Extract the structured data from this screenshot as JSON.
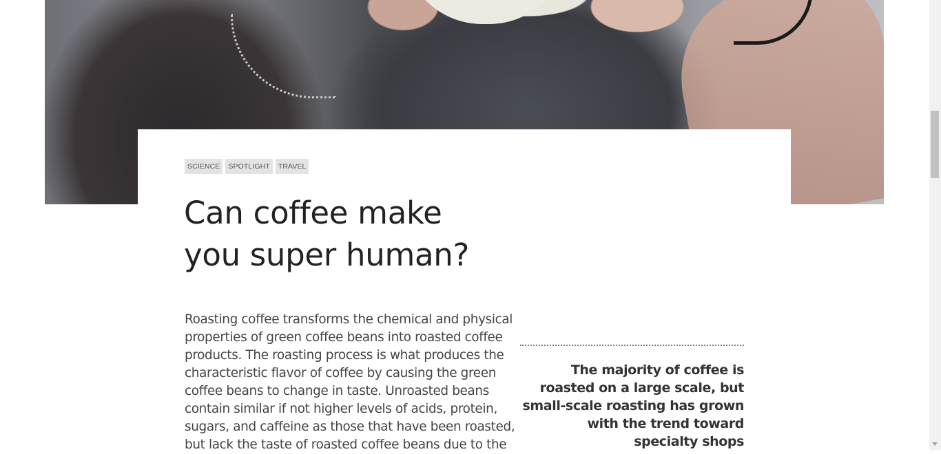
{
  "hero": {
    "image_alt": "person holding a coffee mug"
  },
  "article": {
    "tags": [
      "SCIENCE",
      "SPOTLIGHT",
      "TRAVEL"
    ],
    "title_line1": "Can coffee make",
    "title_line2": "you super human?",
    "body": "Roasting coffee transforms the chemical and physical properties of green coffee beans into roasted coffee products. The roasting process is what produces the characteristic flavor of coffee by causing the green coffee beans to change in taste. Unroasted beans contain similar if not higher levels of acids, protein, sugars, and caffeine as those that have been roasted, but lack the taste of roasted coffee beans due to the",
    "pull_quote": "The majority of coffee is roasted on a large scale, but small-scale roasting has grown with the trend toward specialty shops"
  }
}
